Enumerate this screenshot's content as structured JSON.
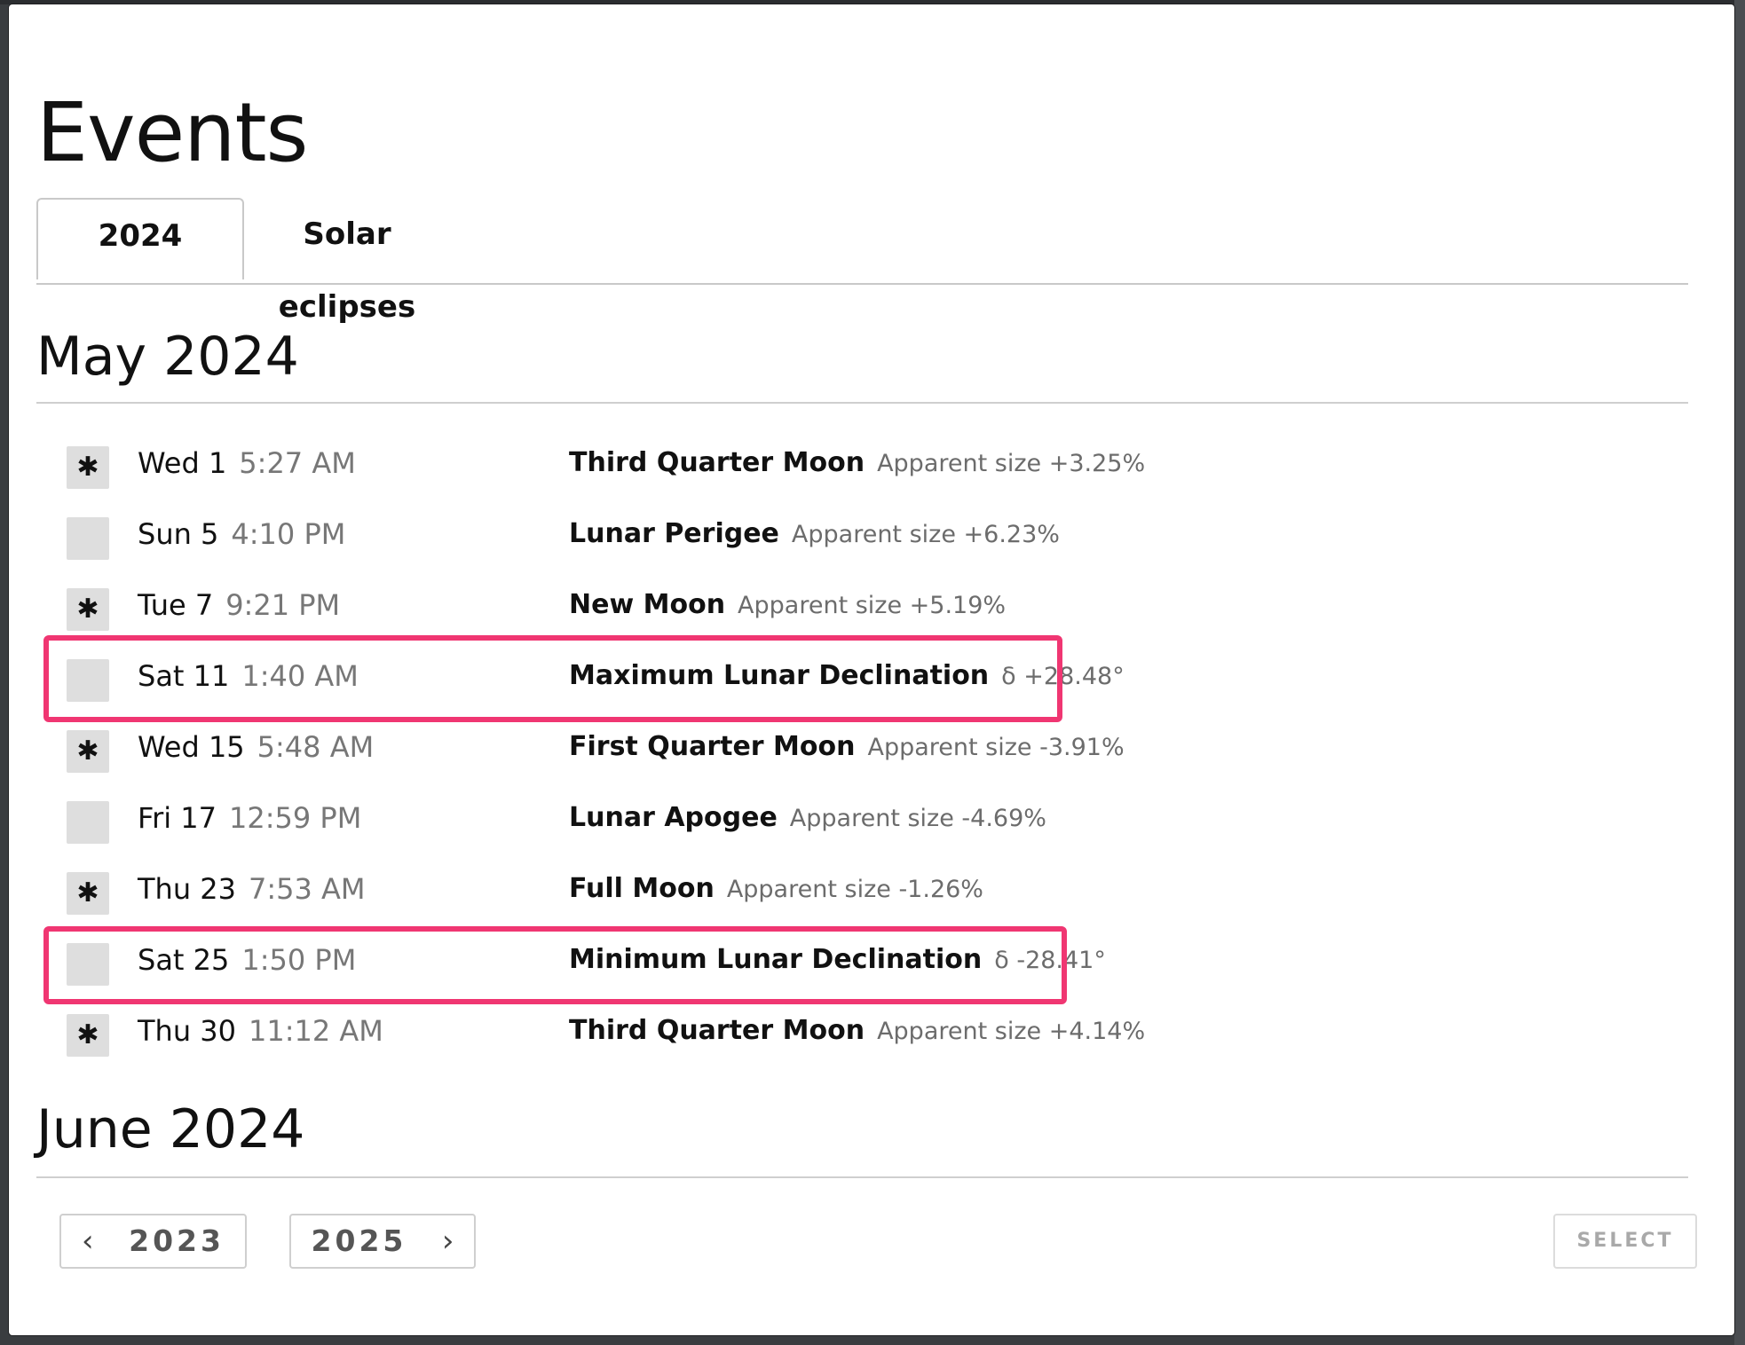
{
  "page": {
    "title": "Events"
  },
  "tabs": [
    {
      "label": "2024",
      "active": true
    },
    {
      "label": "Solar eclipses",
      "active": false
    }
  ],
  "months": [
    {
      "heading": "May 2024"
    },
    {
      "heading": "June 2024"
    }
  ],
  "events": [
    {
      "checked": true,
      "day": "Wed 1",
      "time": "5:27 AM",
      "name": "Third Quarter Moon",
      "detail": "Apparent size +3.25%"
    },
    {
      "checked": false,
      "day": "Sun 5",
      "time": "4:10 PM",
      "name": "Lunar Perigee",
      "detail": "Apparent size +6.23%"
    },
    {
      "checked": true,
      "day": "Tue 7",
      "time": "9:21 PM",
      "name": "New Moon",
      "detail": "Apparent size +5.19%"
    },
    {
      "checked": false,
      "day": "Sat 11",
      "time": "1:40 AM",
      "name": "Maximum Lunar Declination",
      "detail": "δ +28.48°",
      "highlighted": true
    },
    {
      "checked": true,
      "day": "Wed 15",
      "time": "5:48 AM",
      "name": "First Quarter Moon",
      "detail": "Apparent size -3.91%"
    },
    {
      "checked": false,
      "day": "Fri 17",
      "time": "12:59 PM",
      "name": "Lunar Apogee",
      "detail": "Apparent size -4.69%"
    },
    {
      "checked": true,
      "day": "Thu 23",
      "time": "7:53 AM",
      "name": "Full Moon",
      "detail": "Apparent size -1.26%"
    },
    {
      "checked": false,
      "day": "Sat 25",
      "time": "1:50 PM",
      "name": "Minimum Lunar Declination",
      "detail": "δ -28.41°",
      "highlighted": true
    },
    {
      "checked": true,
      "day": "Thu 30",
      "time": "11:12 AM",
      "name": "Third Quarter Moon",
      "detail": "Apparent size +4.14%"
    }
  ],
  "footer": {
    "prev_label": "2023",
    "next_label": "2025",
    "select_label": "SELECT"
  },
  "icons": {
    "check_glyph": "✱",
    "chevron_left": "‹",
    "chevron_right": "›"
  },
  "colors": {
    "highlight": "#f03672",
    "checkbox_bg": "#dedede"
  }
}
